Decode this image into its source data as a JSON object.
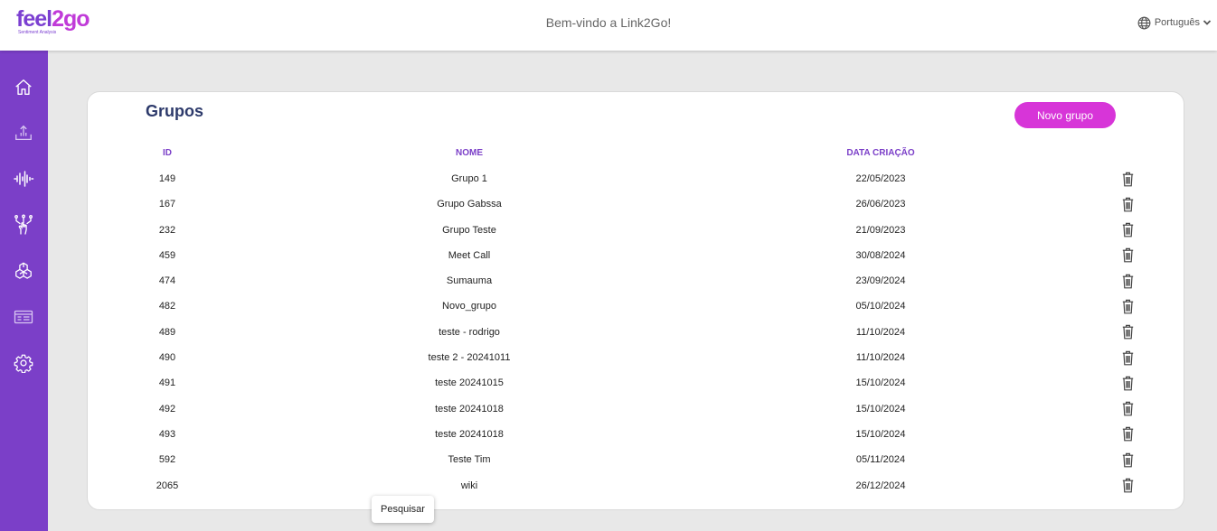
{
  "header": {
    "logo_text": "feel",
    "logo_accent": "2go",
    "logo_tagline": "Sentiment Analysis",
    "welcome": "Bem-vindo a Link2Go!",
    "language": "Português"
  },
  "sidebar": {
    "items": [
      {
        "name": "home",
        "icon": "home-icon"
      },
      {
        "name": "upload",
        "icon": "upload-icon"
      },
      {
        "name": "audio",
        "icon": "audio-wave-icon"
      },
      {
        "name": "hand-network",
        "icon": "hand-network-icon"
      },
      {
        "name": "ai",
        "icon": "ai-knot-icon"
      },
      {
        "name": "panel",
        "icon": "panel-icon"
      },
      {
        "name": "settings",
        "icon": "gear-icon"
      }
    ]
  },
  "page": {
    "title": "Grupos",
    "new_button": "Novo grupo",
    "columns": {
      "id": "ID",
      "name": "NOME",
      "date": "DATA CRIAÇÃO"
    },
    "rows": [
      {
        "id": "149",
        "name": "Grupo 1",
        "date": "22/05/2023"
      },
      {
        "id": "167",
        "name": "Grupo Gabssa",
        "date": "26/06/2023"
      },
      {
        "id": "232",
        "name": "Grupo Teste",
        "date": "21/09/2023"
      },
      {
        "id": "459",
        "name": "Meet Call",
        "date": "30/08/2024"
      },
      {
        "id": "474",
        "name": "Sumauma",
        "date": "23/09/2024"
      },
      {
        "id": "482",
        "name": "Novo_grupo",
        "date": "05/10/2024"
      },
      {
        "id": "489",
        "name": "teste - rodrigo",
        "date": "11/10/2024"
      },
      {
        "id": "490",
        "name": "teste 2 - 20241011",
        "date": "11/10/2024"
      },
      {
        "id": "491",
        "name": "teste 20241015",
        "date": "15/10/2024"
      },
      {
        "id": "492",
        "name": "teste 20241018",
        "date": "15/10/2024"
      },
      {
        "id": "493",
        "name": "teste 20241018",
        "date": "15/10/2024"
      },
      {
        "id": "592",
        "name": "Teste Tim",
        "date": "05/11/2024"
      },
      {
        "id": "2065",
        "name": "wiki",
        "date": "26/12/2024"
      }
    ],
    "row_action_icon": "trash-icon"
  },
  "tooltip": {
    "text": "Pesquisar"
  },
  "colors": {
    "primary": "#7b3fc8",
    "accent": "#d735d8",
    "title": "#2d3a6b",
    "background": "#e8e8e8"
  }
}
